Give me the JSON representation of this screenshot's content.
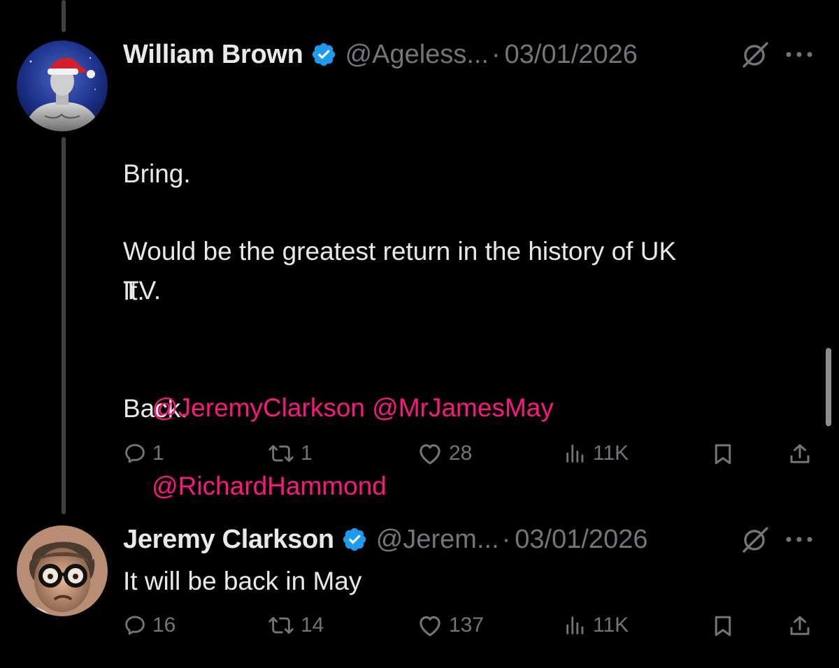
{
  "tweets": [
    {
      "author": {
        "name": "William Brown",
        "handle": "@Ageless...",
        "verified": true,
        "avatar": "santa-hat-statue-avatar"
      },
      "separator": "·",
      "date": "03/01/2026",
      "text_lines": [
        "Bring.",
        "It.",
        "Back."
      ],
      "text_paragraph": "Would be the greatest return in the history of UK\nTV.",
      "mentions": [
        "@JeremyClarkson",
        "@MrJamesMay",
        "@RichardHammond"
      ],
      "stats": {
        "replies": "1",
        "reposts": "1",
        "likes": "28",
        "views": "11K"
      }
    },
    {
      "author": {
        "name": "Jeremy Clarkson",
        "handle": "@Jerem...",
        "verified": true,
        "avatar": "man-with-round-glasses-avatar"
      },
      "separator": "·",
      "date": "03/01/2026",
      "text": "It will be back in May",
      "stats": {
        "replies": "16",
        "reposts": "14",
        "likes": "137",
        "views": "11K"
      }
    }
  ],
  "icons": {
    "reply": "reply-icon",
    "repost": "repost-icon",
    "like": "heart-icon",
    "views": "views-icon",
    "bookmark": "bookmark-icon",
    "share": "share-icon",
    "grok": "grok-icon",
    "more": "more-icon",
    "verified": "verified-badge-icon"
  },
  "colors": {
    "background": "#000000",
    "text": "#e7e9ea",
    "muted": "#71767b",
    "mention": "#f91880",
    "verified": "#1d9bf0"
  }
}
